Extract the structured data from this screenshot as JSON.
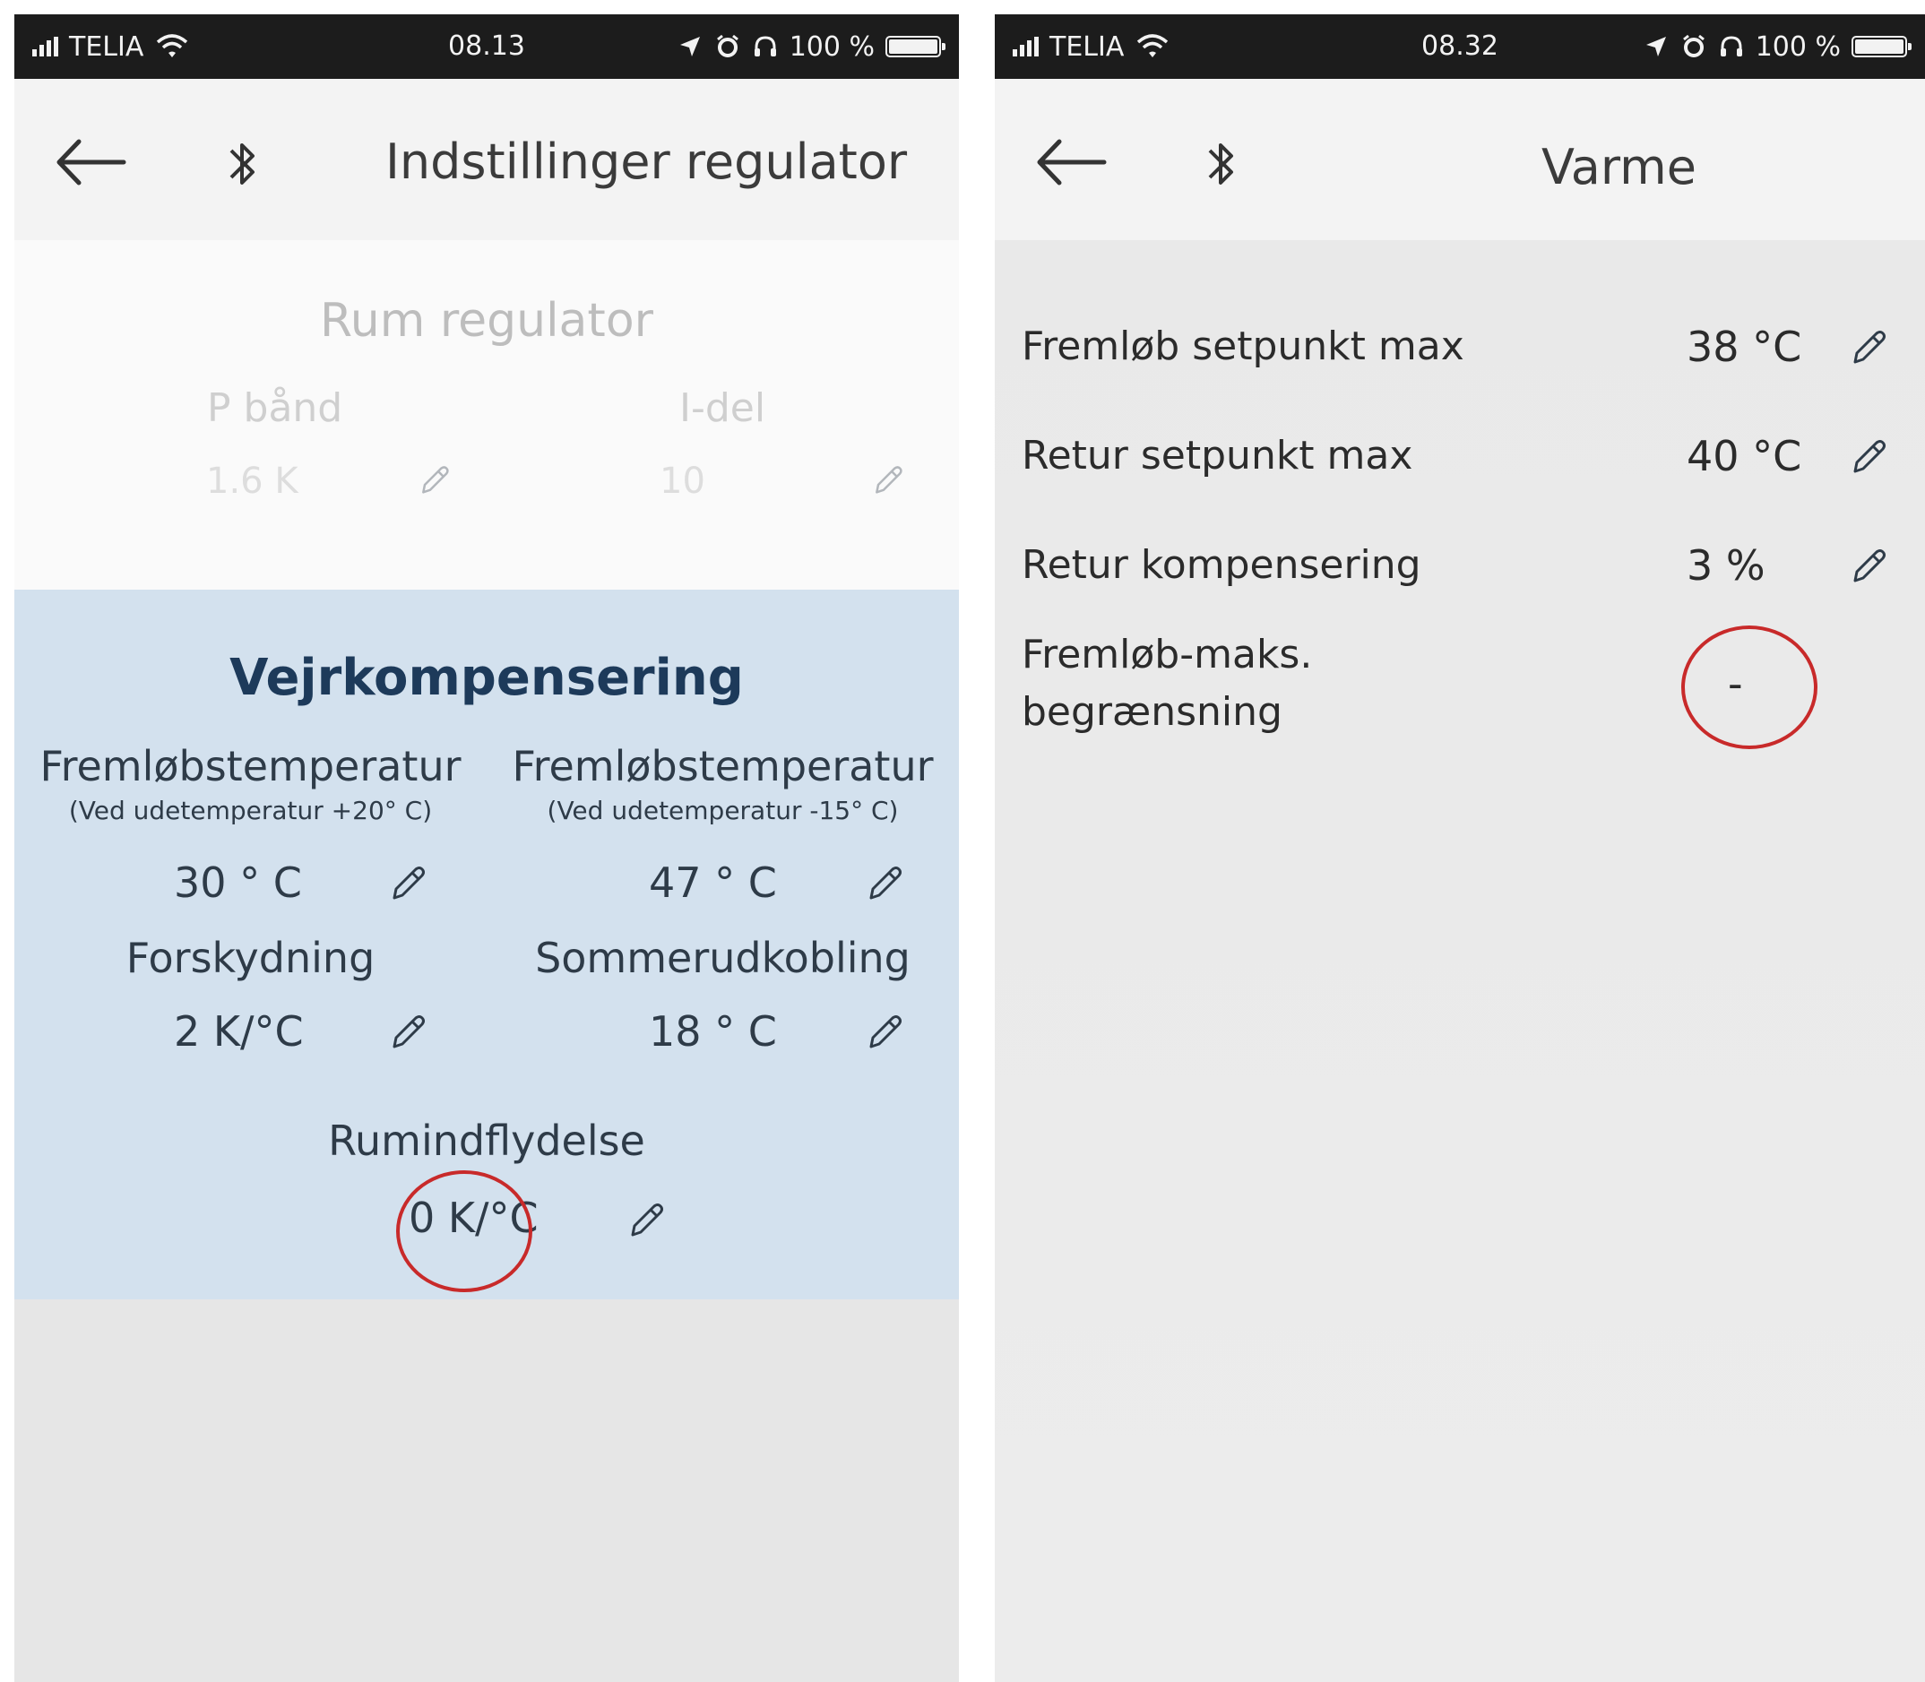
{
  "left_screen": {
    "status": {
      "carrier": "TELIA",
      "time": "08.13",
      "battery": "100 %"
    },
    "header": {
      "title": "Indstillinger regulator"
    },
    "rum_regulator": {
      "title": "Rum regulator",
      "p_band": {
        "label": "P bånd",
        "value": "1.6 K"
      },
      "i_del": {
        "label": "I-del",
        "value": "10"
      }
    },
    "vejrkompensering": {
      "title": "Vejrkompensering",
      "flow_20": {
        "label": "Fremløbstemperatur",
        "sub": "(Ved udetemperatur +20° C)",
        "value": "30 ° C"
      },
      "flow_minus15": {
        "label": "Fremløbstemperatur",
        "sub": "(Ved udetemperatur -15° C)",
        "value": "47 ° C"
      },
      "forskydning": {
        "label": "Forskydning",
        "value": "2 K/°C"
      },
      "sommerudkobling": {
        "label": "Sommerudkobling",
        "value": "18 ° C"
      },
      "rumindflydelse": {
        "label": "Rumindflydelse",
        "value": "0 K/°C"
      }
    }
  },
  "right_screen": {
    "status": {
      "carrier": "TELIA",
      "time": "08.32",
      "battery": "100 %"
    },
    "header": {
      "title": "Varme"
    },
    "settings": [
      {
        "label": "Fremløb setpunkt max",
        "value": "38 °C"
      },
      {
        "label": "Retur setpunkt max",
        "value": "40 °C"
      },
      {
        "label": "Retur kompensering",
        "value": "3 %"
      },
      {
        "label_line1": "Fremløb-maks.",
        "label_line2": "begrænsning",
        "value": "-"
      }
    ]
  },
  "icons": [
    "signal-icon",
    "wifi-icon",
    "location-icon",
    "alarm-icon",
    "headphones-icon",
    "battery-icon",
    "back-arrow-icon",
    "bluetooth-icon",
    "pencil-icon"
  ],
  "colors": {
    "status_bar": "#1c1c1c",
    "vejr_background": "#d3e1ee",
    "vejr_title": "#1d3a5a",
    "highlight_circle": "#c82a2a"
  }
}
